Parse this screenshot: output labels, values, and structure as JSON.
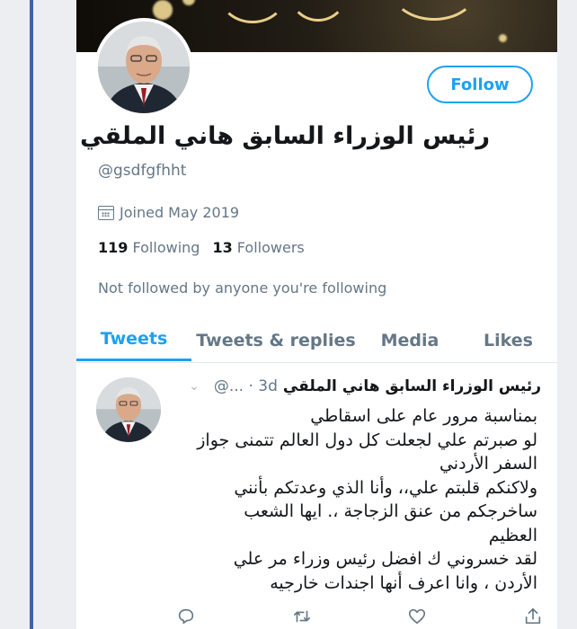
{
  "profile": {
    "display_name": "رئيس الوزراء السابق هاني الملقي",
    "handle": "@gsdfgfhht",
    "joined": "Joined May 2019",
    "following_count": "119",
    "following_label": "Following",
    "followers_count": "13",
    "followers_label": "Followers",
    "not_followed_text": "Not followed by anyone you're following",
    "follow_label": "Follow"
  },
  "tabs": [
    {
      "label": "Tweets",
      "active": true
    },
    {
      "label": "Tweets & replies",
      "active": false
    },
    {
      "label": "Media",
      "active": false
    },
    {
      "label": "Likes",
      "active": false
    }
  ],
  "tweet": {
    "name": "رئيس الوزراء السابق هاني الملقي",
    "meta": "@... · 3d",
    "lines": [
      "بمناسبة مرور عام على اسقاطي",
      "لو صبرتم علي لجعلت كل دول العالم تتمنى جواز",
      "السفر الأردني",
      "ولاكنكم قلبتم علي،، وأنا الذي وعدتكم بأنني",
      "ساخرجكم من عنق الزجاجة ،. ايها الشعب",
      "العظيم",
      "لقد خسروني ك افضل رئيس وزراء مر علي",
      "الأردن ، وانا اعرف أنها اجندات خارجيه"
    ]
  },
  "icons": {
    "accent": "#1da1f2",
    "reply": "reply-icon",
    "retweet": "retweet-icon",
    "like": "like-icon",
    "share": "share-icon",
    "calendar": "calendar-icon",
    "chevron": "chevron-down-icon"
  }
}
